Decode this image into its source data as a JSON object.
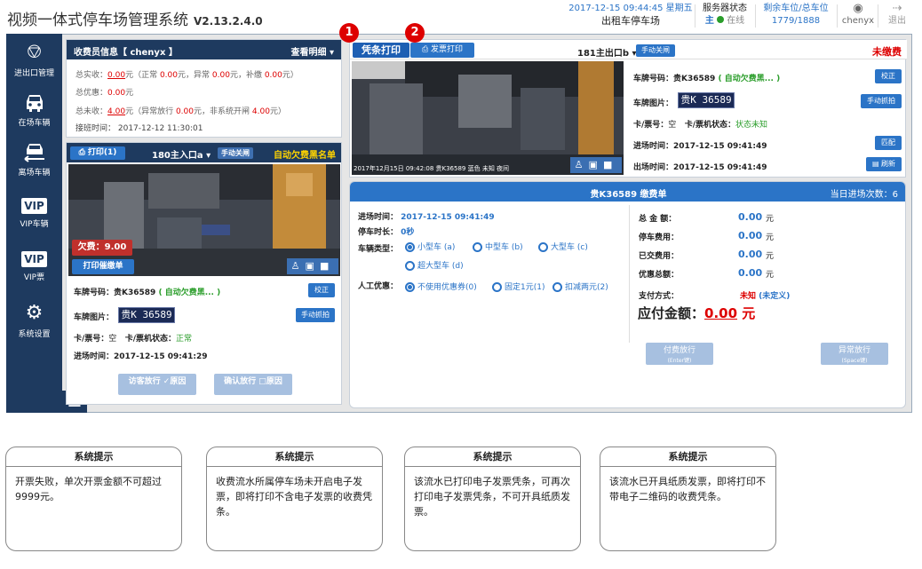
{
  "app": {
    "title": "视频一体式停车场管理系统",
    "version": "V2.13.2.4.0"
  },
  "topbar": {
    "datetime": "2017-12-15 09:44:45 星期五",
    "lot_name": "出租车停车场",
    "server_status_label": "服务器状态",
    "server_role": "主",
    "server_online": "在线",
    "spaces_label": "剩余车位/总车位",
    "spaces_value": "1779/1888",
    "user": "chenyx",
    "logout": "退出"
  },
  "sidebar": {
    "items": [
      {
        "label": "进出口管理",
        "icon": "barrier-gate-icon"
      },
      {
        "label": "在场车辆",
        "icon": "car-icon"
      },
      {
        "label": "离场车辆",
        "icon": "car-exit-icon"
      },
      {
        "label": "VIP车辆",
        "icon": "vip-icon"
      },
      {
        "label": "VIP票",
        "icon": "vip-ticket-icon"
      },
      {
        "label": "系统设置",
        "icon": "gear-icon"
      }
    ],
    "vip_badge": "VIP"
  },
  "cashier": {
    "header": "收费员信息【 chenyx 】",
    "detail_link": "查看明细",
    "line1_pre": "总实收：",
    "line1_total": "0.00",
    "line1_mid": "元（正常",
    "line1_normal": "0.00",
    "line1_abn_label": "元，异常",
    "line1_abn": "0.00",
    "line1_fill_label": "元，补缴",
    "line1_fill": "0.00",
    "line1_end": "元）",
    "line2_pre": "总优惠：",
    "line2_val": "0.00",
    "line2_unit": "元",
    "line3_pre": "总未收：",
    "line3_val": "4.00",
    "line3_mid": "元（异常放行",
    "line3_abn": "0.00",
    "line3_mid2": "元，非系统开闸",
    "line3_nonsys": "4.00",
    "line3_end": "元）",
    "line4": "接班时间： 2017-12-12 11:30:01"
  },
  "entry_lane": {
    "print_btn": "打印(1)",
    "lane": "180主入口a",
    "manual_close": "手动关闸",
    "blacklist": "自动欠费黑名单",
    "arrears_label": "欠费：",
    "arrears_val": "9.00",
    "print_arrears": "打印催缴单",
    "plate_label": "车牌号码：",
    "plate": "贵K36589",
    "plate_hint": "( 自动欠费黑... )",
    "correct": "校正",
    "plate_img_label": "车牌图片：",
    "plate_img_text": "贵K 36589",
    "manual_capture": "手动抓拍",
    "card_label": "卡/票号：",
    "card_val": "空",
    "machine_label": "卡/票机状态：",
    "machine_val": "正常",
    "time_label": "进场时间：",
    "time_val": "2017-12-15 09:41:29",
    "visitor_btn": "访客放行",
    "visitor_reason": "原因",
    "confirm_btn": "确认放行",
    "confirm_reason": "原因"
  },
  "exit_lane": {
    "receipt_btn": "凭条打印",
    "invoice_btn": "发票打印",
    "lane": "181主出口b",
    "manual_close": "手动关闸",
    "unpaid": "未缴费",
    "badge1": "1",
    "badge2": "2",
    "cam_overlay": "2017年12月15日 09:42:08 贵K36589 蓝色 未知 夜间",
    "plate_label": "车牌号码：",
    "plate": "贵K36589",
    "plate_hint": "( 自动欠费黑... )",
    "correct": "校正",
    "plate_img_label": "车牌图片：",
    "plate_img_text": "贵K 36589",
    "manual_capture": "手动抓拍",
    "card_label": "卡/票号：",
    "card_val": "空",
    "machine_label": "卡/票机状态：",
    "machine_val": "状态未知",
    "in_time_label": "进场时间：",
    "in_time": "2017-12-15 09:41:49",
    "match_btn": "匹配",
    "out_time_label": "出场时间：",
    "out_time": "2017-12-15 09:41:49",
    "refresh_btn": "刷新"
  },
  "bill": {
    "title": "贵K36589  缴费单",
    "visits": "当日进场次数：6",
    "in_time_label": "进场时间：",
    "in_time": "2017-12-15 09:41:49",
    "duration_label": "停车时长：",
    "duration": "0秒",
    "type_label": "车辆类型：",
    "types": [
      "小型车 (a)",
      "中型车 (b)",
      "大型车 (c)",
      "超大型车 (d)"
    ],
    "discount_label": "人工优惠：",
    "discounts": [
      "不使用优惠券(0)",
      "固定1元(1)",
      "扣减两元(2)"
    ],
    "total_label": "总 金 额：",
    "total": "0.00",
    "fee_label": "停车费用：",
    "fee": "0.00",
    "paid_label": "已交费用：",
    "paid": "0.00",
    "discount_total_label": "优惠总额：",
    "discount_total": "0.00",
    "unit": "元",
    "paymethod_label": "支付方式：",
    "paymethod": "未知",
    "paymethod_note": "(未定义)",
    "due_label": "应付金额：",
    "due": "0.00",
    "due_unit": "元",
    "pay_btn": "付费放行",
    "pay_key": "(Enter键)",
    "abn_btn": "异常放行",
    "abn_key": "(Space键)"
  },
  "tips": [
    {
      "title": "系统提示",
      "text": "开票失败，单次开票金额不可超过9999元。"
    },
    {
      "title": "系统提示",
      "text": "收费流水所属停车场未开启电子发票，即将打印不含电子发票的收费凭条。"
    },
    {
      "title": "系统提示",
      "text": "该流水已打印电子发票凭条，可再次打印电子发票凭条，不可开具纸质发票。"
    },
    {
      "title": "系统提示",
      "text": "该流水已开具纸质发票，即将打印不带电子二维码的收费凭条。"
    }
  ],
  "colors": {
    "navy": "#1e3a5f",
    "accent": "#2b74c7",
    "alert": "#dd0000",
    "ok": "#2a9d2a"
  }
}
